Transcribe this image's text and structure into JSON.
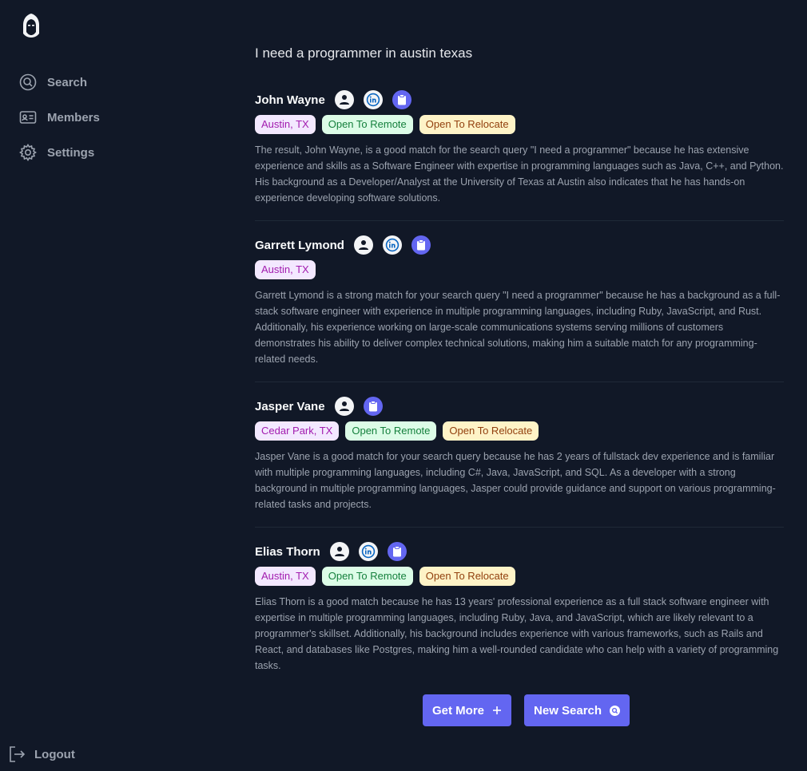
{
  "sidebar": {
    "items": [
      {
        "label": "Search",
        "icon": "search-icon"
      },
      {
        "label": "Members",
        "icon": "id-card-icon"
      },
      {
        "label": "Settings",
        "icon": "gear-icon"
      }
    ],
    "logout_label": "Logout"
  },
  "main": {
    "query": "I need a programmer in austin texas",
    "results": [
      {
        "name": "John Wayne",
        "location": "Austin, TX",
        "remote": "Open To Remote",
        "relocate": "Open To Relocate",
        "description": "The result, John Wayne, is a good match for the search query \"I need a programmer\" because he has extensive experience and skills as a Software Engineer with expertise in programming languages such as Java, C++, and Python. His background as a Developer/Analyst at the University of Texas at Austin also indicates that he has hands-on experience developing software solutions."
      },
      {
        "name": "Garrett Lymond",
        "location": "Austin, TX",
        "description": "Garrett Lymond is a strong match for your search query \"I need a programmer\" because he has a background as a full-stack software engineer with experience in multiple programming languages, including Ruby, JavaScript, and Rust. Additionally, his experience working on large-scale communications systems serving millions of customers demonstrates his ability to deliver complex technical solutions, making him a suitable match for any programming-related needs."
      },
      {
        "name": "Jasper Vane",
        "location": "Cedar Park, TX",
        "remote": "Open To Remote",
        "relocate": "Open To Relocate",
        "description": "Jasper Vane is a good match for your search query because he has 2 years of fullstack dev experience and is familiar with multiple programming languages, including C#, Java, JavaScript, and SQL. As a developer with a strong background in multiple programming languages, Jasper could provide guidance and support on various programming-related tasks and projects."
      },
      {
        "name": "Elias Thorn",
        "location": "Austin, TX",
        "remote": "Open To Remote",
        "relocate": "Open To Relocate",
        "description": "Elias Thorn is a good match because he has 13 years' professional experience as a full stack software engineer with expertise in multiple programming languages, including Ruby, Java, and JavaScript, which are likely relevant to a programmer's skillset. Additionally, his background includes experience with various frameworks, such as Rails and React, and databases like Postgres, making him a well-rounded candidate who can help with a variety of programming tasks."
      }
    ]
  },
  "actions": {
    "get_more_label": "Get More",
    "new_search_label": "New Search"
  },
  "colors": {
    "background": "#111827",
    "accent": "#6366f1",
    "muted_text": "#9ca3af"
  }
}
